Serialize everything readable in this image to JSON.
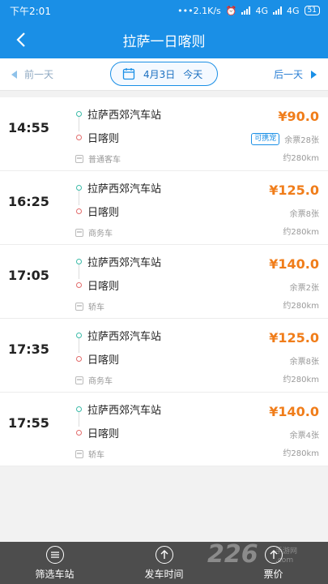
{
  "status": {
    "time": "下午2:01",
    "net_speed": "2.1K/s",
    "sig1": "4G",
    "sig2": "4G",
    "battery": "51"
  },
  "header": {
    "title": "拉萨一日喀则"
  },
  "datebar": {
    "prev": "前一天",
    "date": "4月3日",
    "weekday": "今天",
    "next": "后一天"
  },
  "trips": [
    {
      "time": "14:55",
      "from": "拉萨西郊汽车站",
      "to": "日喀则",
      "type": "普通客车",
      "price": "¥90.0",
      "pet_badge": "可携宠",
      "seats": "余票28张",
      "distance": "约280km"
    },
    {
      "time": "16:25",
      "from": "拉萨西郊汽车站",
      "to": "日喀则",
      "type": "商务车",
      "price": "¥125.0",
      "seats": "余票8张",
      "distance": "约280km"
    },
    {
      "time": "17:05",
      "from": "拉萨西郊汽车站",
      "to": "日喀则",
      "type": "轿车",
      "price": "¥140.0",
      "seats": "余票2张",
      "distance": "约280km"
    },
    {
      "time": "17:35",
      "from": "拉萨西郊汽车站",
      "to": "日喀则",
      "type": "商务车",
      "price": "¥125.0",
      "seats": "余票8张",
      "distance": "约280km"
    },
    {
      "time": "17:55",
      "from": "拉萨西郊汽车站",
      "to": "日喀则",
      "type": "轿车",
      "price": "¥140.0",
      "seats": "余票4张",
      "distance": "约280km"
    }
  ],
  "tabs": {
    "filter": "筛选车站",
    "depart": "发车时间",
    "price": "票价"
  },
  "watermark": {
    "text": "226",
    "site1": "手游网",
    "site2": ".com"
  },
  "colors": {
    "primary": "#1a8fe6",
    "price": "#f07d1a",
    "bottom": "#4d4d4d"
  }
}
